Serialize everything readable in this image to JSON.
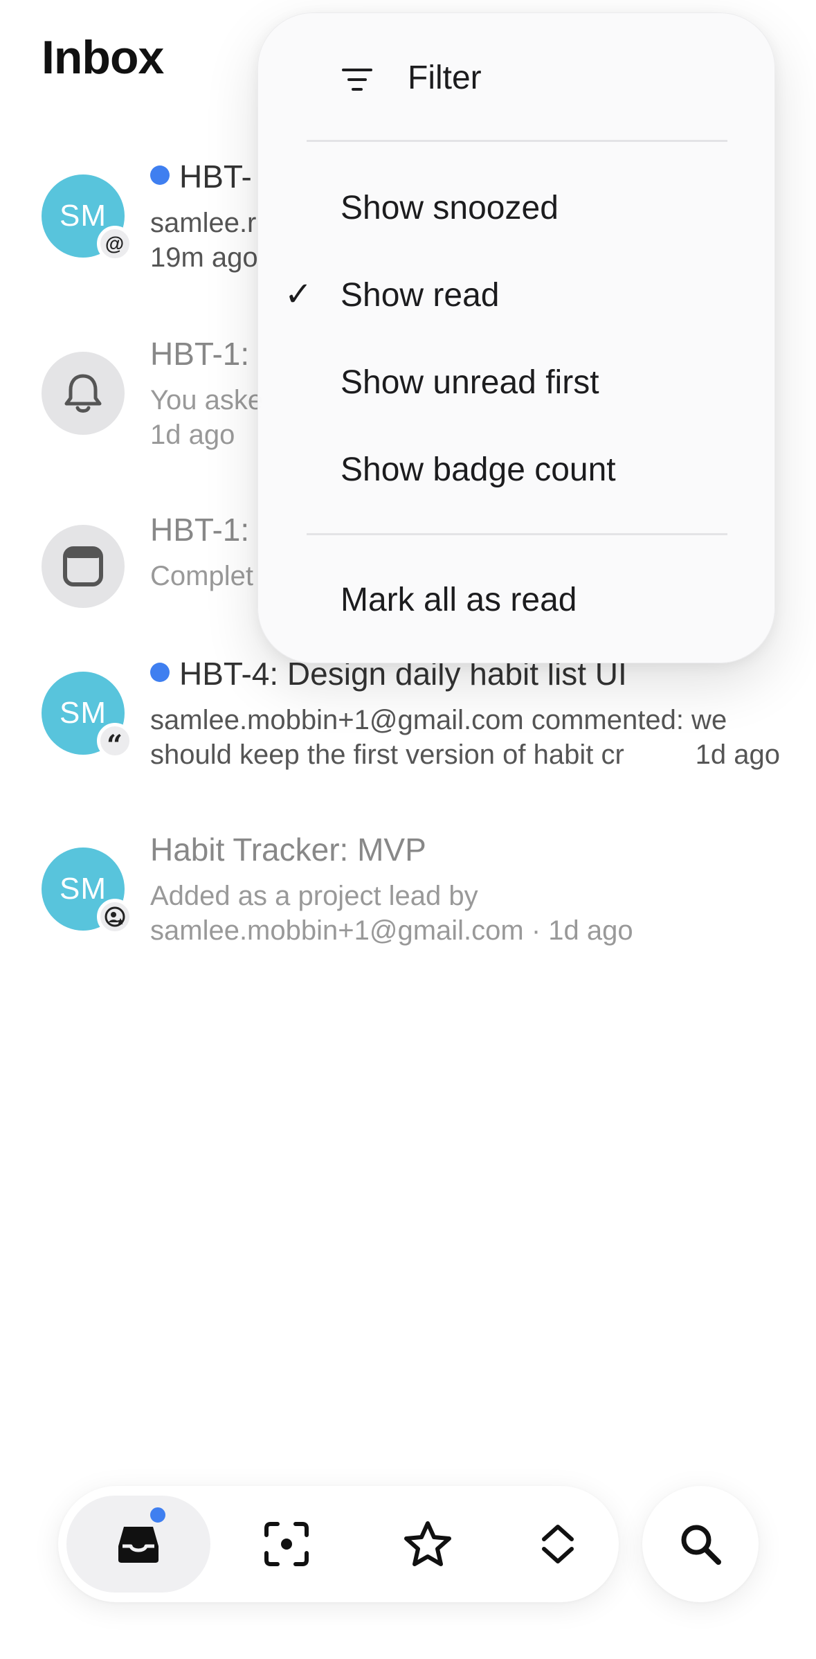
{
  "header": {
    "title": "Inbox"
  },
  "inbox": {
    "items": [
      {
        "avatar_text": "SM",
        "badge_icon": "at-sign-icon",
        "title": "HBT-",
        "line1": "samlee.r",
        "line2": "19m ago",
        "unread": true
      },
      {
        "avatar_icon": "bell-icon",
        "title": "HBT-1:",
        "line1": "You aske",
        "line2": "1d ago",
        "unread": false
      },
      {
        "avatar_icon": "window-icon",
        "title": "HBT-1:",
        "line1": "Complet",
        "unread": false
      },
      {
        "avatar_text": "SM",
        "badge_icon": "quote-icon",
        "title": "HBT-4: Design daily habit list UI",
        "line1": "samlee.mobbin+1@gmail.com commented: we",
        "line2": "should keep the first version of habit cr",
        "line2_time": "1d ago",
        "unread": true
      },
      {
        "avatar_text": "SM",
        "badge_icon": "project-lead-icon",
        "title": "Habit Tracker: MVP",
        "line1": "Added as a project lead by",
        "line2": "samlee.mobbin+1@gmail.com · 1d ago",
        "unread": false
      }
    ]
  },
  "menu": {
    "header_label": "Filter",
    "header_icon": "filter-icon",
    "items": [
      {
        "label": "Show snoozed",
        "checked": false
      },
      {
        "label": "Show read",
        "checked": true,
        "check_glyph": "✓"
      },
      {
        "label": "Show unread first",
        "checked": false
      },
      {
        "label": "Show badge count",
        "checked": false
      }
    ],
    "footer_label": "Mark all as read"
  },
  "tabbar": {
    "tabs": [
      {
        "icon": "inbox-tray-icon",
        "active": true,
        "has_dot": true
      },
      {
        "icon": "focus-scan-icon"
      },
      {
        "icon": "star-icon"
      },
      {
        "icon": "chevron-up-down-icon"
      }
    ],
    "search_icon": "search-icon"
  },
  "colors": {
    "accent_blue": "#3f7ff0",
    "avatar_teal": "#58c4dc"
  }
}
